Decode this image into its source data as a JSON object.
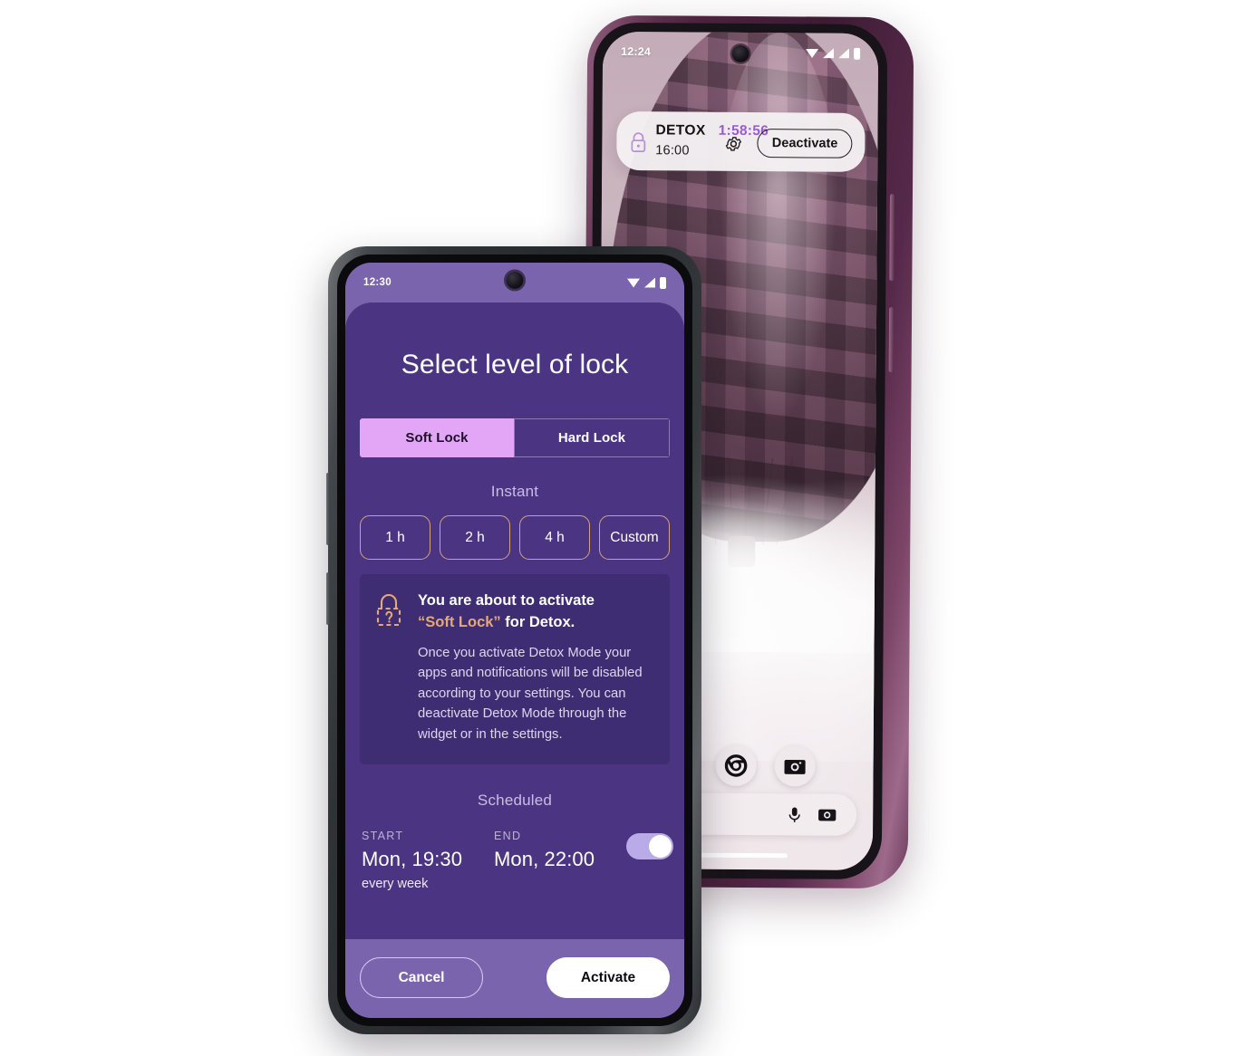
{
  "rear_phone": {
    "status_bar": {
      "time": "12:24",
      "icons": [
        "wifi-icon",
        "signal-icon",
        "signal-icon",
        "battery-icon"
      ]
    },
    "widget": {
      "lock_icon": "lock-icon",
      "title": "DETOX",
      "timer": "1:58:56",
      "schedule_time": "16:00",
      "gear_icon": "gear-icon",
      "deactivate_label": "Deactivate",
      "timer_color": "#9a5ad8",
      "card_bg": "#f4f0f2"
    },
    "dock": {
      "apps": [
        "play-store-icon",
        "chrome-icon",
        "camera-icon"
      ],
      "search_icons": [
        "microphone-icon",
        "lens-camera-icon"
      ]
    },
    "frame_color": "#5c2f4c"
  },
  "front_phone": {
    "status_bar": {
      "time": "12:30",
      "icons": [
        "wifi-icon",
        "signal-icon",
        "battery-icon"
      ]
    },
    "screen": {
      "title": "Select level of lock",
      "lock_level_tabs": [
        {
          "label": "Soft Lock",
          "active": true
        },
        {
          "label": "Hard Lock",
          "active": false
        }
      ],
      "instant": {
        "label": "Instant",
        "chips": [
          "1 h",
          "2 h",
          "4 h",
          "Custom"
        ]
      },
      "info_card": {
        "icon": "lock-question-icon",
        "heading_line1": "You are about to activate",
        "heading_line2_quoted": "“Soft Lock”",
        "heading_line2_rest": " for Detox.",
        "body": "Once you activate Detox Mode your apps and notifications will be disabled according to your settings. You can deactivate Detox Mode through the widget or in the settings.",
        "accent_color": "#e5a878"
      },
      "scheduled": {
        "label": "Scheduled",
        "start_caption": "START",
        "start_value": "Mon, 19:30",
        "start_repeat": "every week",
        "end_caption": "END",
        "end_value": "Mon, 22:00",
        "toggle_on": true
      },
      "footer": {
        "cancel_label": "Cancel",
        "activate_label": "Activate"
      },
      "colors": {
        "sheet": "#4b3583",
        "status_bg": "#7a64ad",
        "active_tab": "#e3a6f7",
        "card": "#3e2d72"
      }
    },
    "frame_color": "#303336"
  }
}
